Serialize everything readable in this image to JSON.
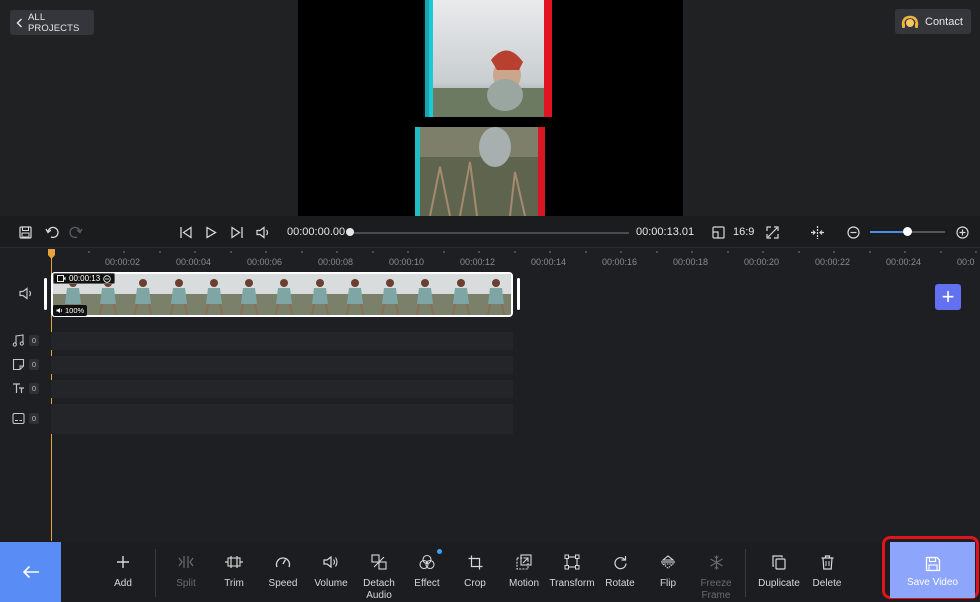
{
  "header": {
    "all_projects_label": "ALL PROJECTS",
    "contact_label": "Contact"
  },
  "playbar": {
    "current_time": "00:00:00.00",
    "total_time": "00:00:13.01",
    "aspect_ratio": "16:9"
  },
  "timeline": {
    "ruler_labels": [
      "00:00:02",
      "00:00:04",
      "00:00:06",
      "00:00:08",
      "00:00:10",
      "00:00:12",
      "00:00:14",
      "00:00:16",
      "00:00:18",
      "00:00:20",
      "00:00:22",
      "00:00:24",
      "00:0"
    ],
    "clip": {
      "duration": "00:00:13",
      "volume": "100%"
    },
    "tracks": [
      {
        "name": "music",
        "icon": "music-note-icon",
        "count": "0"
      },
      {
        "name": "sticker",
        "icon": "sticker-icon",
        "count": "0"
      },
      {
        "name": "text",
        "icon": "text-icon",
        "count": "0"
      },
      {
        "name": "subtitle",
        "icon": "subtitle-icon",
        "count": "0"
      }
    ]
  },
  "toolbar": {
    "add": "Add",
    "split": "Split",
    "trim": "Trim",
    "speed": "Speed",
    "volume": "Volume",
    "detach_audio_1": "Detach",
    "detach_audio_2": "Audio",
    "effect": "Effect",
    "crop": "Crop",
    "motion": "Motion",
    "transform": "Transform",
    "rotate": "Rotate",
    "flip": "Flip",
    "freeze_1": "Freeze",
    "freeze_2": "Frame",
    "duplicate": "Duplicate",
    "delete": "Delete",
    "save_video": "Save Video"
  },
  "colors": {
    "accent_blue": "#5a8cf5",
    "save_button": "#8da5fb",
    "add_track": "#6271f0",
    "playhead": "#e8a33a",
    "highlight_border": "#e0141a"
  }
}
